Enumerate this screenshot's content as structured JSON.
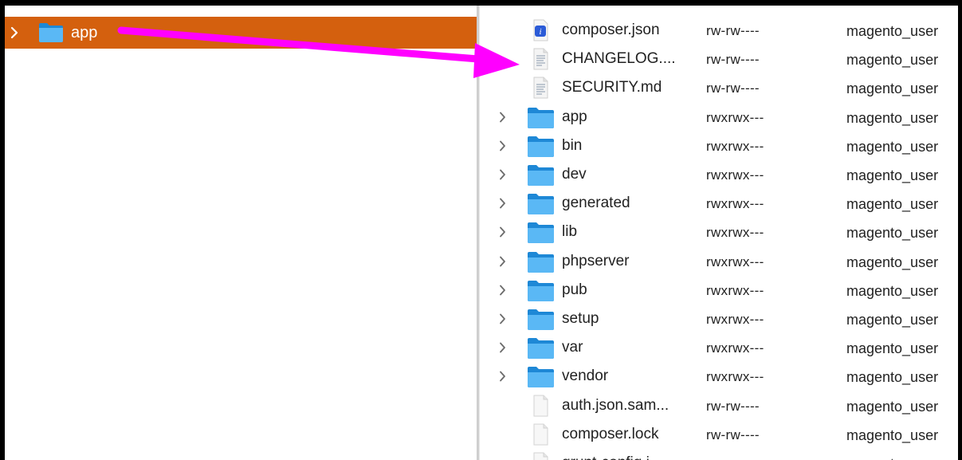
{
  "left_pane": {
    "selected_item": {
      "label": "app",
      "icon": "folder-icon"
    }
  },
  "right_pane": {
    "rows": [
      {
        "name": "composer.json",
        "perm": "rw-rw----",
        "owner": "magento_user",
        "type": "json",
        "expandable": false
      },
      {
        "name": "CHANGELOG....",
        "perm": "rw-rw----",
        "owner": "magento_user",
        "type": "text",
        "expandable": false
      },
      {
        "name": "SECURITY.md",
        "perm": "rw-rw----",
        "owner": "magento_user",
        "type": "text",
        "expandable": false
      },
      {
        "name": "app",
        "perm": "rwxrwx---",
        "owner": "magento_user",
        "type": "folder",
        "expandable": true
      },
      {
        "name": "bin",
        "perm": "rwxrwx---",
        "owner": "magento_user",
        "type": "folder",
        "expandable": true
      },
      {
        "name": "dev",
        "perm": "rwxrwx---",
        "owner": "magento_user",
        "type": "folder",
        "expandable": true
      },
      {
        "name": "generated",
        "perm": "rwxrwx---",
        "owner": "magento_user",
        "type": "folder",
        "expandable": true
      },
      {
        "name": "lib",
        "perm": "rwxrwx---",
        "owner": "magento_user",
        "type": "folder",
        "expandable": true
      },
      {
        "name": "phpserver",
        "perm": "rwxrwx---",
        "owner": "magento_user",
        "type": "folder",
        "expandable": true
      },
      {
        "name": "pub",
        "perm": "rwxrwx---",
        "owner": "magento_user",
        "type": "folder",
        "expandable": true
      },
      {
        "name": "setup",
        "perm": "rwxrwx---",
        "owner": "magento_user",
        "type": "folder",
        "expandable": true
      },
      {
        "name": "var",
        "perm": "rwxrwx---",
        "owner": "magento_user",
        "type": "folder",
        "expandable": true
      },
      {
        "name": "vendor",
        "perm": "rwxrwx---",
        "owner": "magento_user",
        "type": "folder",
        "expandable": true
      },
      {
        "name": "auth.json.sam...",
        "perm": "rw-rw----",
        "owner": "magento_user",
        "type": "blank",
        "expandable": false
      },
      {
        "name": "composer.lock",
        "perm": "rw-rw----",
        "owner": "magento_user",
        "type": "blank",
        "expandable": false
      },
      {
        "name": "grunt-config.j...",
        "perm": "rw-rw----",
        "owner": "magento_user",
        "type": "blank",
        "expandable": false
      }
    ]
  },
  "annotation": {
    "icon": "arrow-icon",
    "color": "#ff00ff"
  },
  "colors": {
    "selection": "#d4600e",
    "folder": "#3aa0e6"
  }
}
